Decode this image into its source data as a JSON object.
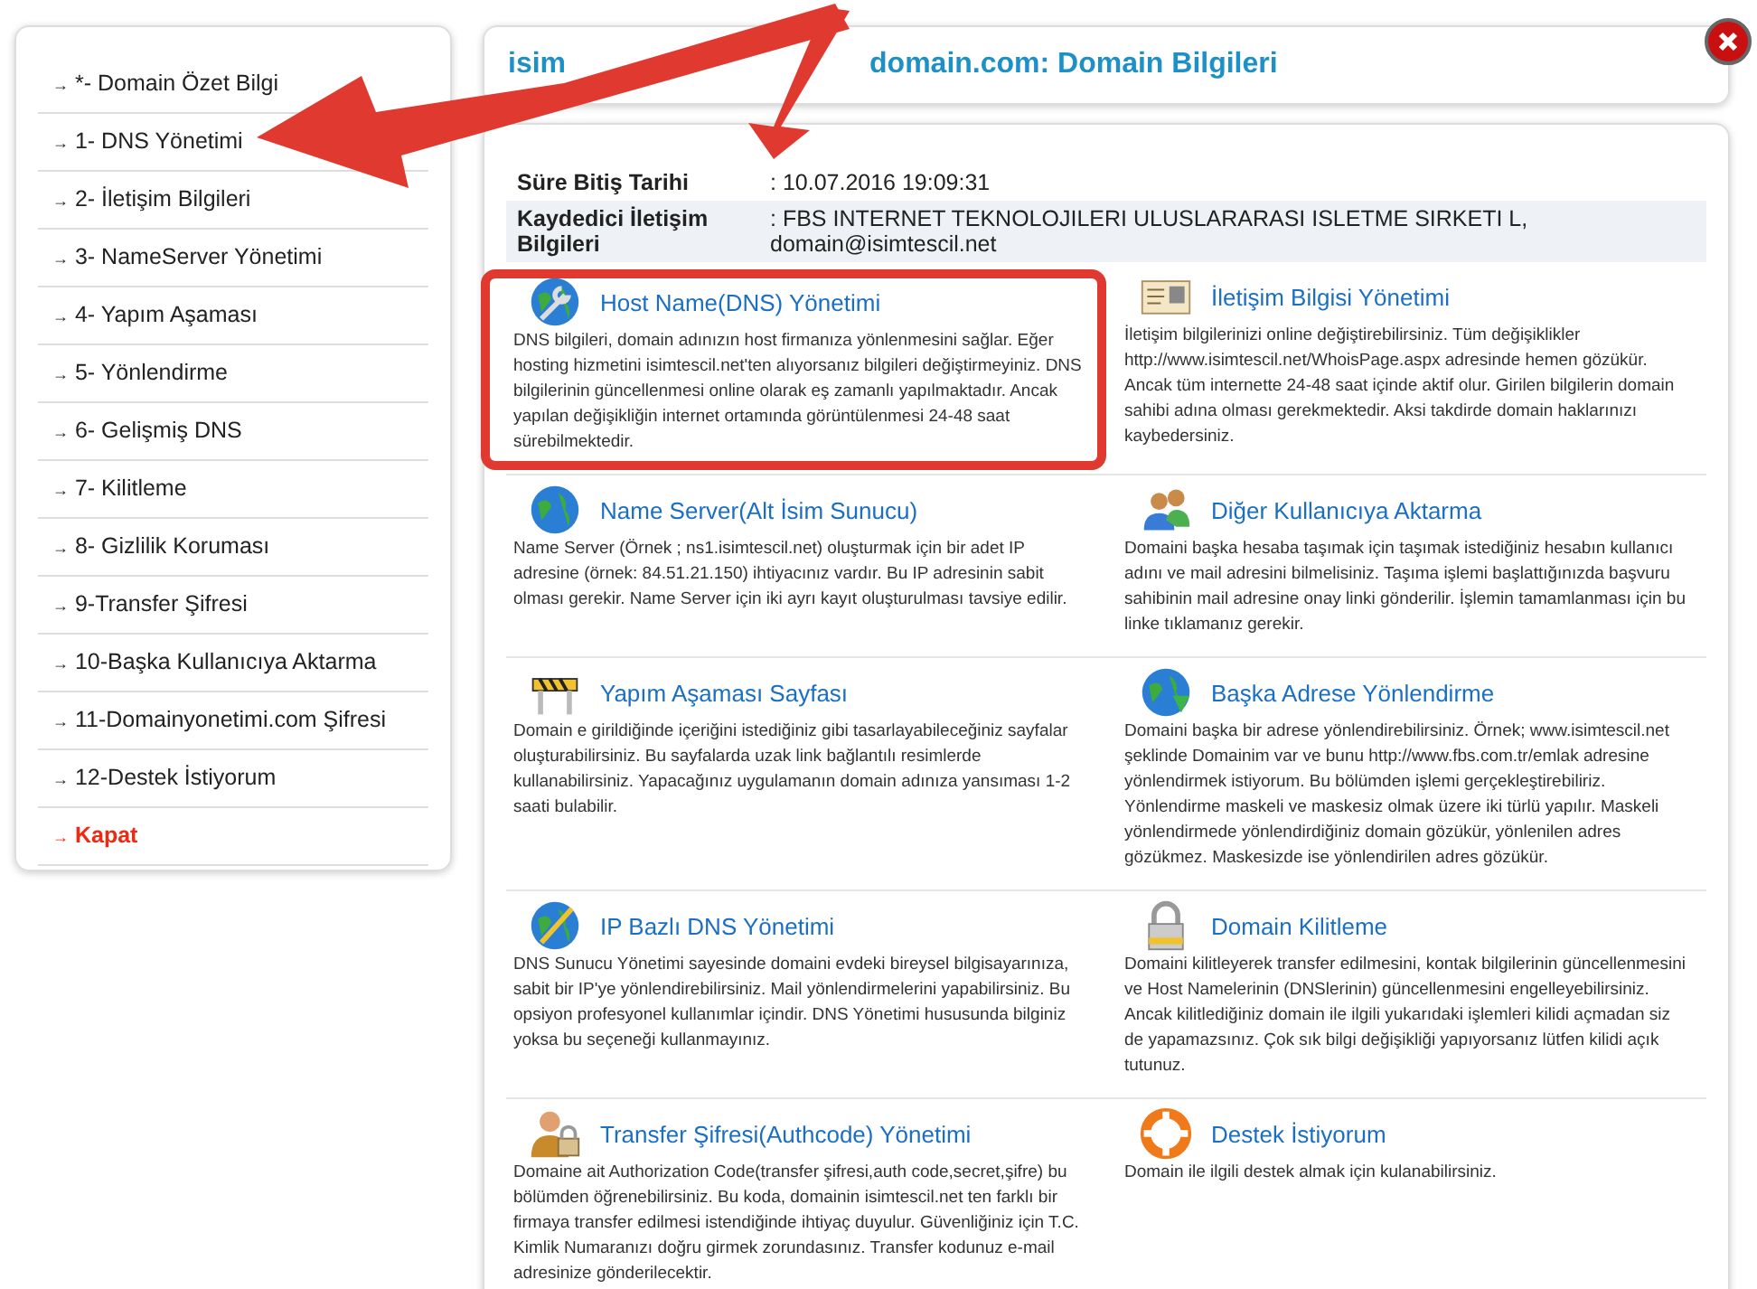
{
  "sidebar": {
    "items": [
      {
        "arrow": "→",
        "label": "*- Domain Özet Bilgi",
        "kind": "link"
      },
      {
        "arrow": "→",
        "label": "1- DNS Yönetimi",
        "kind": "link"
      },
      {
        "arrow": "→",
        "label": "2- İletişim Bilgileri",
        "kind": "link"
      },
      {
        "arrow": "→",
        "label": "3- NameServer Yönetimi",
        "kind": "link"
      },
      {
        "arrow": "→",
        "label": "4- Yapım Aşaması",
        "kind": "link"
      },
      {
        "arrow": "→",
        "label": "5- Yönlendirme",
        "kind": "link"
      },
      {
        "arrow": "→",
        "label": "6- Gelişmiş DNS",
        "kind": "link"
      },
      {
        "arrow": "→",
        "label": "7- Kilitleme",
        "kind": "link"
      },
      {
        "arrow": "→",
        "label": "8- Gizlilik Koruması",
        "kind": "link"
      },
      {
        "arrow": "→",
        "label": "9-Transfer Şifresi",
        "kind": "link"
      },
      {
        "arrow": "→",
        "label": "10-Başka Kullanıcıya Aktarma",
        "kind": "link"
      },
      {
        "arrow": "→",
        "label": "11-Domainyonetimi.com Şifresi",
        "kind": "link"
      },
      {
        "arrow": "→",
        "label": "12-Destek İstiyorum",
        "kind": "link"
      },
      {
        "arrow": "→",
        "label": "Kapat",
        "kind": "close"
      }
    ]
  },
  "header": {
    "title_start": "isim",
    "title_end": "domain.com: Domain Bilgileri"
  },
  "info": [
    {
      "label": "Süre Bitiş Tarihi",
      "value": ": 10.07.2016 19:09:31"
    },
    {
      "label": "Kaydedici İletişim Bilgileri",
      "value": ": FBS INTERNET TEKNOLOJILERI ULUSLARARASI ISLETME SIRKETI L, domain@isimtescil.net"
    }
  ],
  "sections": [
    {
      "title": "Host Name(DNS) Yönetimi",
      "text": "DNS bilgileri, domain adınızın host firmanıza yönlenmesini sağlar. Eğer hosting hizmetini isimtescil.net'ten alıyorsanız bilgileri değiştirmeyiniz. DNS bilgilerinin güncellenmesi online olarak eş zamanlı yapılmaktadır. Ancak yapılan değişikliğin internet ortamında görüntülenmesi 24-48 saat sürebilmektedir."
    },
    {
      "title": "İletişim Bilgisi Yönetimi",
      "text": "İletişim bilgilerinizi online değiştirebilirsiniz. Tüm değişiklikler http://www.isimtescil.net/WhoisPage.aspx adresinde hemen gözükür. Ancak tüm internette 24-48 saat içinde aktif olur. Girilen bilgilerin domain sahibi adına olması gerekmektedir. Aksi takdirde domain haklarınızı kaybedersiniz."
    },
    {
      "title": "Name Server(Alt İsim Sunucu)",
      "text": "Name Server (Örnek ; ns1.isimtescil.net) oluşturmak için bir adet IP adresine (örnek: 84.51.21.150) ihtiyacınız vardır. Bu IP adresinin sabit olması gerekir. Name Server için iki ayrı kayıt oluşturulması tavsiye edilir."
    },
    {
      "title": "Diğer Kullanıcıya Aktarma",
      "text": "Domaini başka hesaba taşımak için taşımak istediğiniz hesabın kullanıcı adını ve mail adresini bilmelisiniz. Taşıma işlemi başlattığınızda başvuru sahibinin mail adresine onay linki gönderilir. İşlemin tamamlanması için bu linke tıklamanız gerekir."
    },
    {
      "title": "Yapım Aşaması Sayfası",
      "text": "Domain e girildiğinde içeriğini istediğiniz gibi tasarlayabileceğiniz sayfalar oluşturabilirsiniz. Bu sayfalarda uzak link bağlantılı resimlerde kullanabilirsiniz. Yapacağınız uygulamanın domain adınıza yansıması 1-2 saati bulabilir."
    },
    {
      "title": "Başka Adrese Yönlendirme",
      "text": "Domaini başka bir adrese yönlendirebilirsiniz. Örnek; www.isimtescil.net şeklinde Domainim var ve bunu http://www.fbs.com.tr/emlak adresine yönlendirmek istiyorum. Bu bölümden işlemi gerçekleştirebiliriz. Yönlendirme maskeli ve maskesiz olmak üzere iki türlü yapılır. Maskeli yönlendirmede yönlendirdiğiniz domain gözükür, yönlenilen adres gözükmez. Maskesizde ise yönlendirilen adres gözükür."
    },
    {
      "title": "IP Bazlı DNS Yönetimi",
      "text": "DNS Sunucu Yönetimi sayesinde domaini evdeki bireysel bilgisayarınıza, sabit bir IP'ye yönlendirebilirsiniz. Mail yönlendirmelerini yapabilirsiniz. Bu opsiyon profesyonel kullanımlar içindir. DNS Yönetimi hususunda bilginiz yoksa bu seçeneği kullanmayınız."
    },
    {
      "title": "Domain Kilitleme",
      "text": "Domaini kilitleyerek transfer edilmesini, kontak bilgilerinin güncellenmesini ve Host Namelerinin (DNSlerinin) güncellenmesini engelleyebilirsiniz. Ancak kilitlediğiniz domain ile ilgili yukarıdaki işlemleri kilidi açmadan siz de yapamazsınız. Çok sık bilgi değişikliği yapıyorsanız lütfen kilidi açık tutunuz."
    },
    {
      "title": "Transfer Şifresi(Authcode) Yönetimi",
      "text": "Domaine ait Authorization Code(transfer şifresi,auth code,secret,şifre) bu bölümden öğrenebilirsiniz. Bu koda, domainin isimtescil.net ten farklı bir firmaya transfer edilmesi istendiğinde ihtiyaç duyulur. Güvenliğiniz için T.C. Kimlik Numaranızı doğru girmek zorundasınız. Transfer kodunuz e-mail adresinize gönderilecektir."
    },
    {
      "title": "Destek İstiyorum",
      "text": "Domain ile ilgili destek almak için kulanabilirsiniz."
    }
  ]
}
